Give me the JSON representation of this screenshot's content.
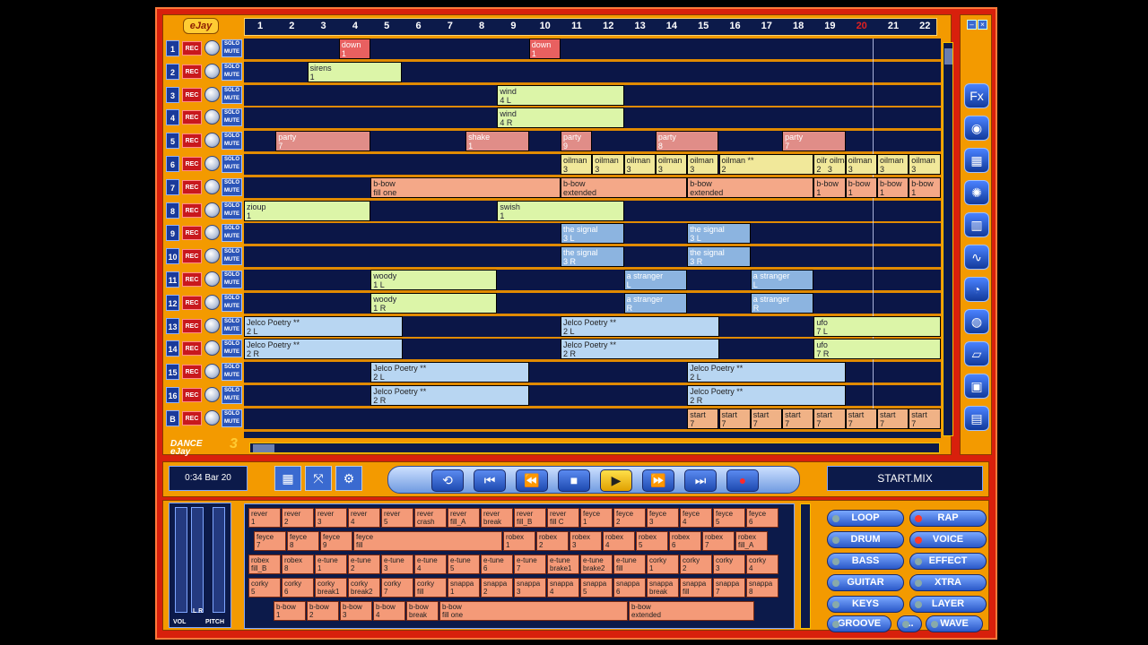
{
  "app": {
    "logo": "eJay",
    "brand_line1": "DANCE",
    "brand_line2": "eJay",
    "brand_version": "3"
  },
  "ruler": {
    "bars": [
      "1",
      "2",
      "3",
      "4",
      "5",
      "6",
      "7",
      "8",
      "9",
      "10",
      "11",
      "12",
      "13",
      "14",
      "15",
      "16",
      "17",
      "18",
      "19",
      "20",
      "21",
      "22"
    ],
    "highlight": "20"
  },
  "track_labels": {
    "rec": "REC",
    "solo": "SOLO",
    "mute": "MUTE"
  },
  "tracks": [
    "1",
    "2",
    "3",
    "4",
    "5",
    "6",
    "7",
    "8",
    "9",
    "10",
    "11",
    "12",
    "13",
    "14",
    "15",
    "16",
    "B"
  ],
  "blocks": [
    {
      "lane": 0,
      "start": 3,
      "len": 1,
      "color": "red",
      "text": "down\n1"
    },
    {
      "lane": 0,
      "start": 9,
      "len": 1,
      "color": "red",
      "text": "down\n1"
    },
    {
      "lane": 1,
      "start": 2,
      "len": 3,
      "color": "lgreen",
      "text": "sirens\n1"
    },
    {
      "lane": 2,
      "start": 8,
      "len": 4,
      "color": "lgreen",
      "text": "wind\n4 L"
    },
    {
      "lane": 3,
      "start": 8,
      "len": 4,
      "color": "lgreen",
      "text": "wind\n4 R"
    },
    {
      "lane": 4,
      "start": 1,
      "len": 3,
      "color": "pink",
      "text": "party\n7"
    },
    {
      "lane": 4,
      "start": 7,
      "len": 2,
      "color": "pink",
      "text": "shake\n1"
    },
    {
      "lane": 4,
      "start": 10,
      "len": 1,
      "color": "pink",
      "text": "party\n9"
    },
    {
      "lane": 4,
      "start": 13,
      "len": 2,
      "color": "pink",
      "text": "party\n8"
    },
    {
      "lane": 4,
      "start": 17,
      "len": 2,
      "color": "pink",
      "text": "party\n7"
    },
    {
      "lane": 5,
      "start": 10,
      "len": 1,
      "color": "yellow",
      "text": "oilman\n3"
    },
    {
      "lane": 5,
      "start": 11,
      "len": 1,
      "color": "yellow",
      "text": "oilman\n3"
    },
    {
      "lane": 5,
      "start": 12,
      "len": 1,
      "color": "yellow",
      "text": "oilman\n3"
    },
    {
      "lane": 5,
      "start": 13,
      "len": 1,
      "color": "yellow",
      "text": "oilman\n3"
    },
    {
      "lane": 5,
      "start": 14,
      "len": 1,
      "color": "yellow",
      "text": "oilman\n3"
    },
    {
      "lane": 5,
      "start": 15,
      "len": 3,
      "color": "yellow",
      "text": "oilman **\n2"
    },
    {
      "lane": 5,
      "start": 18,
      "len": 1,
      "color": "yellow",
      "text": "oilr oilman\n2   3"
    },
    {
      "lane": 5,
      "start": 19,
      "len": 1,
      "color": "yellow",
      "text": "oilman\n3"
    },
    {
      "lane": 5,
      "start": 20,
      "len": 1,
      "color": "yellow",
      "text": "oilman\n3"
    },
    {
      "lane": 5,
      "start": 21,
      "len": 1,
      "color": "yellow",
      "text": "oilman\n3"
    },
    {
      "lane": 6,
      "start": 4,
      "len": 6,
      "color": "salmon",
      "text": "b-bow\nfill one"
    },
    {
      "lane": 6,
      "start": 10,
      "len": 4,
      "color": "salmon",
      "text": "b-bow\nextended"
    },
    {
      "lane": 6,
      "start": 14,
      "len": 4,
      "color": "salmon",
      "text": "b-bow\nextended"
    },
    {
      "lane": 6,
      "start": 18,
      "len": 1,
      "color": "salmon",
      "text": "b-bow\n1"
    },
    {
      "lane": 6,
      "start": 19,
      "len": 1,
      "color": "salmon",
      "text": "b-bow\n1"
    },
    {
      "lane": 6,
      "start": 20,
      "len": 1,
      "color": "salmon",
      "text": "b-bow\n1"
    },
    {
      "lane": 6,
      "start": 21,
      "len": 1,
      "color": "salmon",
      "text": "b-bow\n1"
    },
    {
      "lane": 7,
      "start": 0,
      "len": 4,
      "color": "lgreen",
      "text": "zioup\n1"
    },
    {
      "lane": 7,
      "start": 8,
      "len": 4,
      "color": "lgreen",
      "text": "swish\n1"
    },
    {
      "lane": 8,
      "start": 10,
      "len": 2,
      "color": "blue",
      "text": "the signal\n3 L"
    },
    {
      "lane": 8,
      "start": 14,
      "len": 2,
      "color": "blue",
      "text": "the signal\n3 L"
    },
    {
      "lane": 9,
      "start": 10,
      "len": 2,
      "color": "blue",
      "text": "the signal\n3 R"
    },
    {
      "lane": 9,
      "start": 14,
      "len": 2,
      "color": "blue",
      "text": "the signal\n3 R"
    },
    {
      "lane": 10,
      "start": 4,
      "len": 4,
      "color": "lgreen",
      "text": "woody\n1 L"
    },
    {
      "lane": 10,
      "start": 12,
      "len": 2,
      "color": "blue",
      "text": "a stranger\nL"
    },
    {
      "lane": 10,
      "start": 16,
      "len": 2,
      "color": "blue",
      "text": "a stranger\nL"
    },
    {
      "lane": 11,
      "start": 4,
      "len": 4,
      "color": "lgreen",
      "text": "woody\n1 R"
    },
    {
      "lane": 11,
      "start": 12,
      "len": 2,
      "color": "blue",
      "text": "a stranger\nR"
    },
    {
      "lane": 11,
      "start": 16,
      "len": 2,
      "color": "blue",
      "text": "a stranger\nR"
    },
    {
      "lane": 12,
      "start": 0,
      "len": 5,
      "color": "lblue",
      "text": "Jelco Poetry **\n2 L"
    },
    {
      "lane": 12,
      "start": 10,
      "len": 5,
      "color": "lblue",
      "text": "Jelco Poetry **\n2 L"
    },
    {
      "lane": 12,
      "start": 18,
      "len": 4,
      "color": "lgreen",
      "text": "ufo\n7 L"
    },
    {
      "lane": 13,
      "start": 0,
      "len": 5,
      "color": "lblue",
      "text": "Jelco Poetry **\n2 R"
    },
    {
      "lane": 13,
      "start": 10,
      "len": 5,
      "color": "lblue",
      "text": "Jelco Poetry **\n2 R"
    },
    {
      "lane": 13,
      "start": 18,
      "len": 4,
      "color": "lgreen",
      "text": "ufo\n7 R"
    },
    {
      "lane": 14,
      "start": 4,
      "len": 5,
      "color": "lblue",
      "text": "Jelco Poetry **\n2 L"
    },
    {
      "lane": 14,
      "start": 14,
      "len": 5,
      "color": "lblue",
      "text": "Jelco Poetry **\n2 L"
    },
    {
      "lane": 15,
      "start": 4,
      "len": 5,
      "color": "lblue",
      "text": "Jelco Poetry **\n2 R"
    },
    {
      "lane": 15,
      "start": 14,
      "len": 5,
      "color": "lblue",
      "text": "Jelco Poetry **\n2 R"
    },
    {
      "lane": 16,
      "start": 14,
      "len": 1,
      "color": "start",
      "text": "start\n7"
    },
    {
      "lane": 16,
      "start": 15,
      "len": 1,
      "color": "start",
      "text": "start\n7"
    },
    {
      "lane": 16,
      "start": 16,
      "len": 1,
      "color": "start",
      "text": "start\n7"
    },
    {
      "lane": 16,
      "start": 17,
      "len": 1,
      "color": "start",
      "text": "start\n7"
    },
    {
      "lane": 16,
      "start": 18,
      "len": 1,
      "color": "start",
      "text": "start\n7"
    },
    {
      "lane": 16,
      "start": 19,
      "len": 1,
      "color": "start",
      "text": "start\n7"
    },
    {
      "lane": 16,
      "start": 20,
      "len": 1,
      "color": "start",
      "text": "start\n7"
    },
    {
      "lane": 16,
      "start": 21,
      "len": 1,
      "color": "start",
      "text": "start\n7"
    }
  ],
  "sidebar_icons": [
    "effects-icon",
    "mixer-icon",
    "grid-icon",
    "wave-icon",
    "bars-icon",
    "tilde-icon",
    "clock-icon",
    "globe-icon",
    "eraser-icon",
    "save-icon",
    "file-icon"
  ],
  "transport": {
    "time": "0:34  Bar 20",
    "mix_name": "START.MIX"
  },
  "mixer": {
    "vol": "VOL",
    "pitch": "PITCH",
    "lr": "L   R"
  },
  "samples": [
    [
      "rever\n1",
      "rever\n2",
      "rever\n3",
      "rever\n4",
      "rever\n5",
      "rever\ncrash",
      "rever\nfill_A",
      "rever\nbreak",
      "rever\nfill_B",
      "rever\nfill C",
      "feyce\n1",
      "feyce\n2",
      "feyce\n3",
      "feyce\n4",
      "feyce\n5",
      "feyce\n6"
    ],
    [
      "feyce\n7",
      "feyce\n8",
      "feyce\n9",
      "feyce\nfill",
      "robex\n1",
      "robex\n2",
      "robex\n3",
      "robex\n4",
      "robex\n5",
      "robex\n6",
      "robex\n7",
      "robex\nfill_A"
    ],
    [
      "robex\nfill_B",
      "robex\n8",
      "e-tune\n1",
      "e-tune\n2",
      "e-tune\n3",
      "e-tune\n4",
      "e-tune\n5",
      "e-tune\n6",
      "e-tune\n7",
      "e-tune\nbrake1",
      "e-tune\nbrake2",
      "e-tune\nfill",
      "corky\n1",
      "corky\n2",
      "corky\n3",
      "corky\n4"
    ],
    [
      "corky\n5",
      "corky\n6",
      "corky\nbreak1",
      "corky\nbreak2",
      "corky\n7",
      "corky\nfill",
      "snappa\n1",
      "snappa\n2",
      "snappa\n3",
      "snappa\n4",
      "snappa\n5",
      "snappa\n6",
      "snappa\nbreak",
      "snappa\nfill",
      "snappa\n7",
      "snappa\n8"
    ],
    [
      "b-bow\n1",
      "b-bow\n2",
      "b-bow\n3",
      "b-bow\n4",
      "b-bow\nbreak",
      "b-bow\nfill one",
      "b-bow\nextended"
    ]
  ],
  "categories": [
    {
      "label": "LOOP",
      "on": false
    },
    {
      "label": "RAP",
      "on": true
    },
    {
      "label": "DRUM",
      "on": false
    },
    {
      "label": "VOICE",
      "on": true
    },
    {
      "label": "BASS",
      "on": false
    },
    {
      "label": "EFFECT",
      "on": false
    },
    {
      "label": "GUITAR",
      "on": false
    },
    {
      "label": "XTRA",
      "on": false
    },
    {
      "label": "KEYS",
      "on": false
    },
    {
      "label": "LAYER",
      "on": false
    },
    {
      "label": "GROOVE",
      "on": false
    },
    {
      "label": "...",
      "on": false
    },
    {
      "label": "WAVE",
      "on": false
    }
  ]
}
